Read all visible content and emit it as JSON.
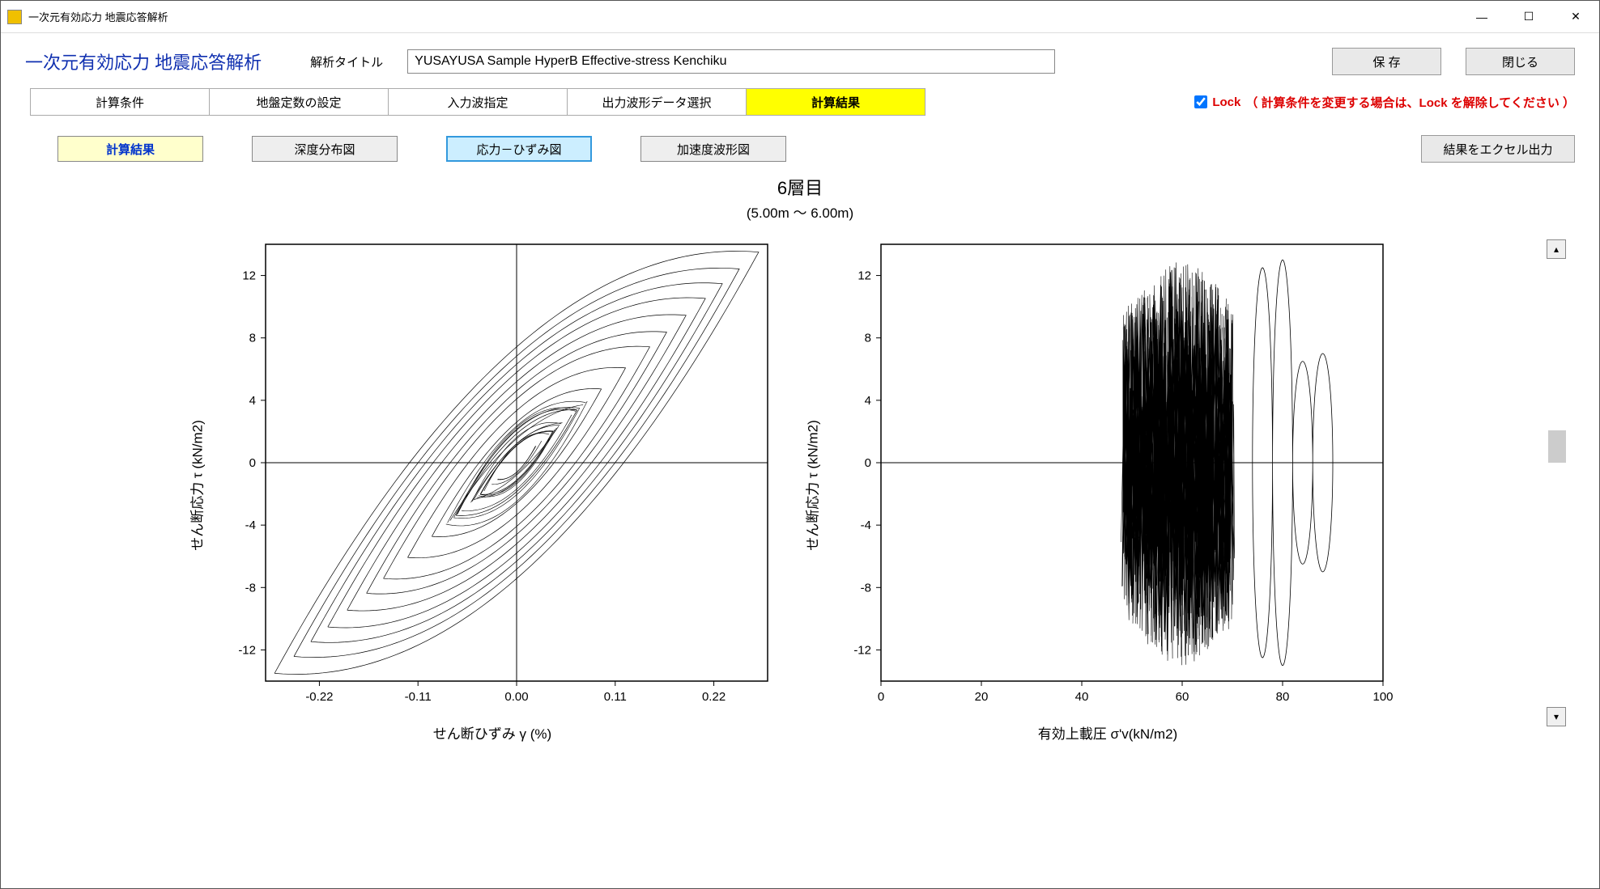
{
  "titlebar": {
    "app_title": "一次元有効応力 地震応答解析"
  },
  "header": {
    "heading": "一次元有効応力 地震応答解析",
    "title_label": "解析タイトル",
    "title_value": "YUSAYUSA Sample HyperB Effective-stress Kenchiku",
    "save_label": "保 存",
    "close_label": "閉じる"
  },
  "tabs": {
    "t1": "計算条件",
    "t2": "地盤定数の設定",
    "t3": "入力波指定",
    "t4": "出力波形データ選択",
    "t5": "計算結果"
  },
  "lock": {
    "label": "Lock",
    "note": "（ 計算条件を変更する場合は、Lock を解除してください ）",
    "checked": true
  },
  "subtabs": {
    "results": "計算結果",
    "depth": "深度分布図",
    "stress": "応力－ひずみ図",
    "wave": "加速度波形図",
    "excel": "結果をエクセル出力"
  },
  "chart_header": {
    "title": "6層目",
    "subtitle": "(5.00m ～ 6.00m)"
  },
  "chart1": {
    "ylabel": "せん断応力  τ (kN/m2)",
    "xlabel": "せん断ひずみ  γ (%)"
  },
  "chart2": {
    "ylabel": "せん断応力  τ (kN/m2)",
    "xlabel": "有効上載圧  σ'v(kN/m2)"
  },
  "chart_data": [
    {
      "type": "line",
      "title": "せん断応力 vs せん断ひずみ (hysteresis loops)",
      "xlabel": "せん断ひずみ γ (%)",
      "ylabel": "せん断応力 τ (kN/m2)",
      "xlim": [
        -0.28,
        0.28
      ],
      "ylim": [
        -14,
        14
      ],
      "xticks": [
        -0.22,
        -0.11,
        0.0,
        0.11,
        0.22
      ],
      "yticks": [
        -12,
        -8,
        -4,
        0,
        4,
        8,
        12
      ],
      "description": "Many overlapping hysteresis loops centered near origin; outermost loop approx passes through (-0.27,-13.5),(-0.11,-10),(0,-4),(0.11,4),(0.24,13),(0.11,10),(0,4),(-0.11,-4),(-0.27,-13.5)."
    },
    {
      "type": "line",
      "title": "せん断応力 vs 有効上載圧 (stress path)",
      "xlabel": "有効上載圧 σ'v (kN/m2)",
      "ylabel": "せん断応力 τ (kN/m2)",
      "xlim": [
        0,
        100
      ],
      "ylim": [
        -14,
        14
      ],
      "xticks": [
        0,
        20,
        40,
        60,
        80,
        100
      ],
      "yticks": [
        -12,
        -8,
        -4,
        0,
        4,
        8,
        12
      ],
      "description": "Dense vertical oscillations concentrated between σ'v ≈ 48 and 90, with amplitude up to about ±13 near σ'v≈62 and narrowing loops toward σ'v≈90 with amplitude ≈±7."
    }
  ]
}
